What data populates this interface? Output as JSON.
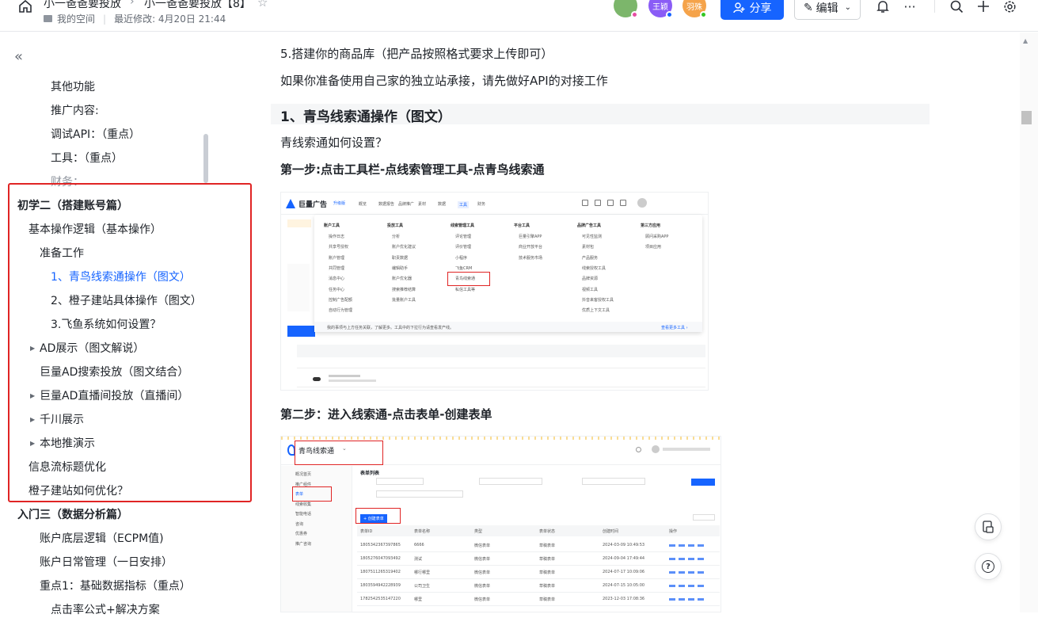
{
  "header": {
    "breadcrumb_1": "小一爸爸要投放",
    "breadcrumb_2": "小一爸爸要投放【8】",
    "space": "我的空间",
    "last_modified": "最近修改: 4月20日 21:44",
    "avatars": [
      {
        "label": "",
        "color": "#7cb66b",
        "dot": "#e64ca3"
      },
      {
        "label": "王颖",
        "color": "#8a5cf6",
        "dot": "#1664ff"
      },
      {
        "label": "羽殊",
        "color": "#f5a34a",
        "dot": "#34c724"
      }
    ],
    "share_label": "分享",
    "edit_label": "编辑"
  },
  "sidebar": {
    "items": [
      {
        "label": "其他功能",
        "indent": 3
      },
      {
        "label": "推广内容:",
        "indent": 3
      },
      {
        "label": "调试API：（重点）",
        "indent": 3
      },
      {
        "label": "工具：（重点）",
        "indent": 3
      },
      {
        "label": "财务：",
        "indent": 3,
        "faded": true
      },
      {
        "label": "初学二（搭建账号篇）",
        "indent": 0,
        "bold": true
      },
      {
        "label": "基本操作逻辑（基本操作）",
        "indent": 1
      },
      {
        "label": "准备工作",
        "indent": 2
      },
      {
        "label": "1、青鸟线索通操作（图文）",
        "indent": 3,
        "active": true
      },
      {
        "label": "2、橙子建站具体操作（图文）",
        "indent": 3
      },
      {
        "label": "3.飞鱼系统如何设置？",
        "indent": 3
      },
      {
        "label": "AD展示（图文解说）",
        "indent": 2,
        "caret": true
      },
      {
        "label": "巨量AD搜索投放（图文结合）",
        "indent": 2
      },
      {
        "label": "巨量AD直播间投放（直播间）",
        "indent": 2,
        "caret": true
      },
      {
        "label": "千川展示",
        "indent": 2,
        "caret": true
      },
      {
        "label": "本地推演示",
        "indent": 2,
        "caret": true
      },
      {
        "label": "信息流标题优化",
        "indent": 1
      },
      {
        "label": "橙子建站如何优化？",
        "indent": 1
      },
      {
        "label": "入门三（数据分析篇）",
        "indent": 0,
        "bold": true
      },
      {
        "label": "账户底层逻辑（ECPM值)",
        "indent": 2
      },
      {
        "label": "账户日常管理（一日安排）",
        "indent": 2
      },
      {
        "label": "重点1：基础数据指标（重点）",
        "indent": 2
      },
      {
        "label": "点击率公式+解决方案",
        "indent": 3
      }
    ]
  },
  "content": {
    "line1": "5.搭建你的商品库（把产品按照格式要求上传即可）",
    "line2": "如果你准备使用自己家的独立站承接，请先做好API的对接工作",
    "heading": "1、青鸟线索通操作（图文）",
    "line3": "青线索通如何设置？",
    "step1": "第一步:点击工具栏-点线索管理工具-点青鸟线索通",
    "step2": "第二步：进入线索通-点击表单-创建表单"
  },
  "screenshot1": {
    "logo": "巨量广告",
    "logo_tag": "升级版",
    "nav": [
      "概览",
      "数据报告",
      "品牌推广",
      "素材",
      "数据",
      "工具",
      "财务"
    ],
    "menu_columns": [
      {
        "title": "账户工具",
        "items": [
          "操作日志",
          "共享号授权",
          "账户管理",
          "共同管理",
          "消息中心",
          "任务中心",
          "控制广告配额",
          "自动行为管理"
        ]
      },
      {
        "title": "投放工具",
        "items": [
          "分析",
          "账户优化建议",
          "职责数据",
          "编辑助手",
          "账户优化器",
          "搜索推荐结算",
          "批量账户工具"
        ]
      },
      {
        "title": "线索管理工具",
        "items": [
          "评论管理",
          "评价管理",
          "小程序",
          "飞鱼CRM",
          "青鸟线索通",
          "私信工具等"
        ]
      },
      {
        "title": "平台工具",
        "items": [
          "巨量引擎APP",
          "商业开放平台",
          "技术服务市场"
        ]
      },
      {
        "title": "品牌广告工具",
        "items": [
          "可见性监测",
          "素材包",
          "产品服务",
          "线索授权工具",
          "品牌资源",
          "视频工具",
          "抖音来客授权工具",
          "优质上下文工具"
        ]
      },
      {
        "title": "第三方应用",
        "items": [
          "顾问采购APP",
          "项目应用"
        ]
      }
    ],
    "footer_tip": "我的事项与上方任务关联，了解更多。工具中的下拉行为请查看发产线。",
    "footer_link": "查看更多工具 ›"
  },
  "screenshot2": {
    "logo": "青鸟线索通",
    "menu": [
      "概况首页",
      "推广组件",
      "表单",
      "线索收集",
      "智能电话",
      "咨询",
      "优惠券",
      "推广咨询"
    ],
    "page_title": "表单列表",
    "create_btn": "+ 创建表单",
    "table_headers": [
      "表单ID",
      "表单名称",
      "类型",
      "表单状态",
      "创建时间",
      "操作"
    ],
    "rows": [
      [
        "1805342367397865",
        "6666",
        "微信表单",
        "草稿表单",
        "2024-03-09 10:49:53"
      ],
      [
        "1805276047093492",
        "测试",
        "微信表单",
        "草稿表单",
        "2024-09-04 17:49:44"
      ],
      [
        "1807511265319402",
        "哪行哪里",
        "微信表单",
        "草稿表单",
        "2024-07-17 10:09:06"
      ],
      [
        "1803594942228939",
        "公司卫生",
        "微信表单",
        "草稿表单",
        "2024-07-15 10:05:00"
      ],
      [
        "1782542535147220",
        "哪里",
        "微信表单",
        "草稿表单",
        "2023-12-03 17:08:36"
      ]
    ]
  }
}
